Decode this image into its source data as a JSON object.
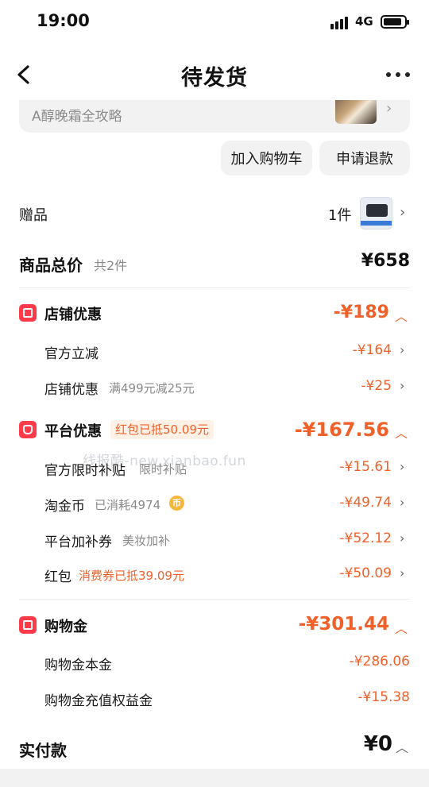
{
  "status_bar": {
    "time": "19:00",
    "network": "4G"
  },
  "nav": {
    "title": "待发货"
  },
  "product": {
    "name_partial": "A醇晚霜全攻略"
  },
  "actions": {
    "add_to_cart": "加入购物车",
    "refund": "申请退款"
  },
  "gift": {
    "label": "赠品",
    "qty": "1件"
  },
  "total": {
    "label": "商品总价",
    "count": "共2件",
    "price": "¥658"
  },
  "shop_discount": {
    "title": "店铺优惠",
    "amount": "-¥189",
    "items": [
      {
        "label": "官方立减",
        "sub": "",
        "amount": "-¥164"
      },
      {
        "label": "店铺优惠",
        "sub": "满499元减25元",
        "amount": "-¥25"
      }
    ]
  },
  "platform_discount": {
    "title": "平台优惠",
    "tag": "红包已抵50.09元",
    "amount": "-¥167.56",
    "items": [
      {
        "label": "官方限时补贴",
        "sub": "限时补贴",
        "amount": "-¥15.61"
      },
      {
        "label": "淘金币",
        "sub": "已消耗4974",
        "amount": "-¥49.74"
      },
      {
        "label": "平台加补券",
        "sub": "美妆加补",
        "amount": "-¥52.12"
      },
      {
        "label": "红包",
        "sub": "消费券已抵39.09元",
        "amount": "-¥50.09"
      }
    ]
  },
  "shopping_gold": {
    "title": "购物金",
    "amount": "-¥301.44",
    "items": [
      {
        "label": "购物金本金",
        "amount": "-¥286.06"
      },
      {
        "label": "购物金充值权益金",
        "amount": "-¥15.38"
      }
    ]
  },
  "paid": {
    "label": "实付款",
    "amount": "¥0"
  },
  "watermark": "线报酷-new.xianbao.fun",
  "colors": {
    "accent": "#f0612a",
    "icon_red": "#ff3b4a",
    "background": "#ffffff"
  }
}
